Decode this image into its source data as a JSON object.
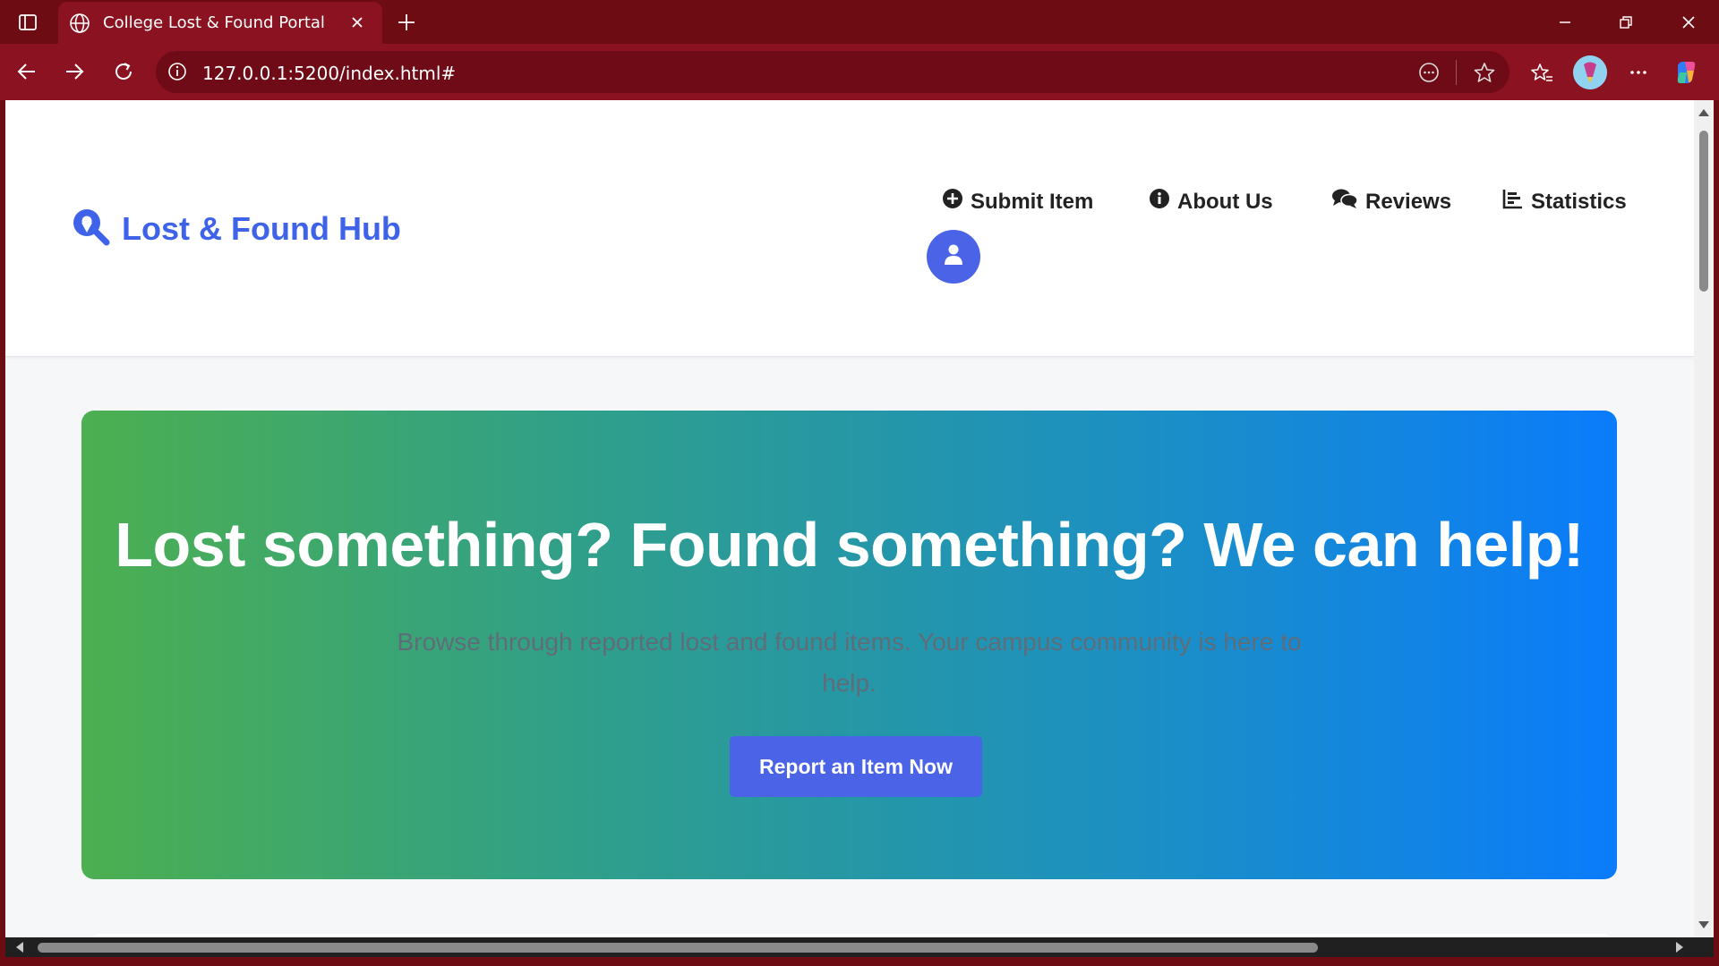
{
  "browser": {
    "tab_title": "College Lost & Found Portal",
    "url": "127.0.0.1:5200/index.html#"
  },
  "site": {
    "logo_text": "Lost & Found Hub",
    "nav": [
      {
        "label": "Submit Item",
        "icon": "plus-circle-icon"
      },
      {
        "label": "About Us",
        "icon": "info-circle-icon"
      },
      {
        "label": "Reviews",
        "icon": "comments-icon"
      },
      {
        "label": "Statistics",
        "icon": "chart-icon"
      }
    ],
    "profile_icon": "user-icon"
  },
  "hero": {
    "title": "Lost something? Found something? We can help!",
    "subtitle": "Browse through reported lost and found items. Your campus community is here to help.",
    "cta_label": "Report an Item Now"
  },
  "colors": {
    "brand_blue": "#4a63e7",
    "logo_blue": "#3f63e8",
    "hero_gradient_start": "#4caf50",
    "hero_gradient_end": "#0a7cfb",
    "browser_frame": "#8b1220"
  }
}
